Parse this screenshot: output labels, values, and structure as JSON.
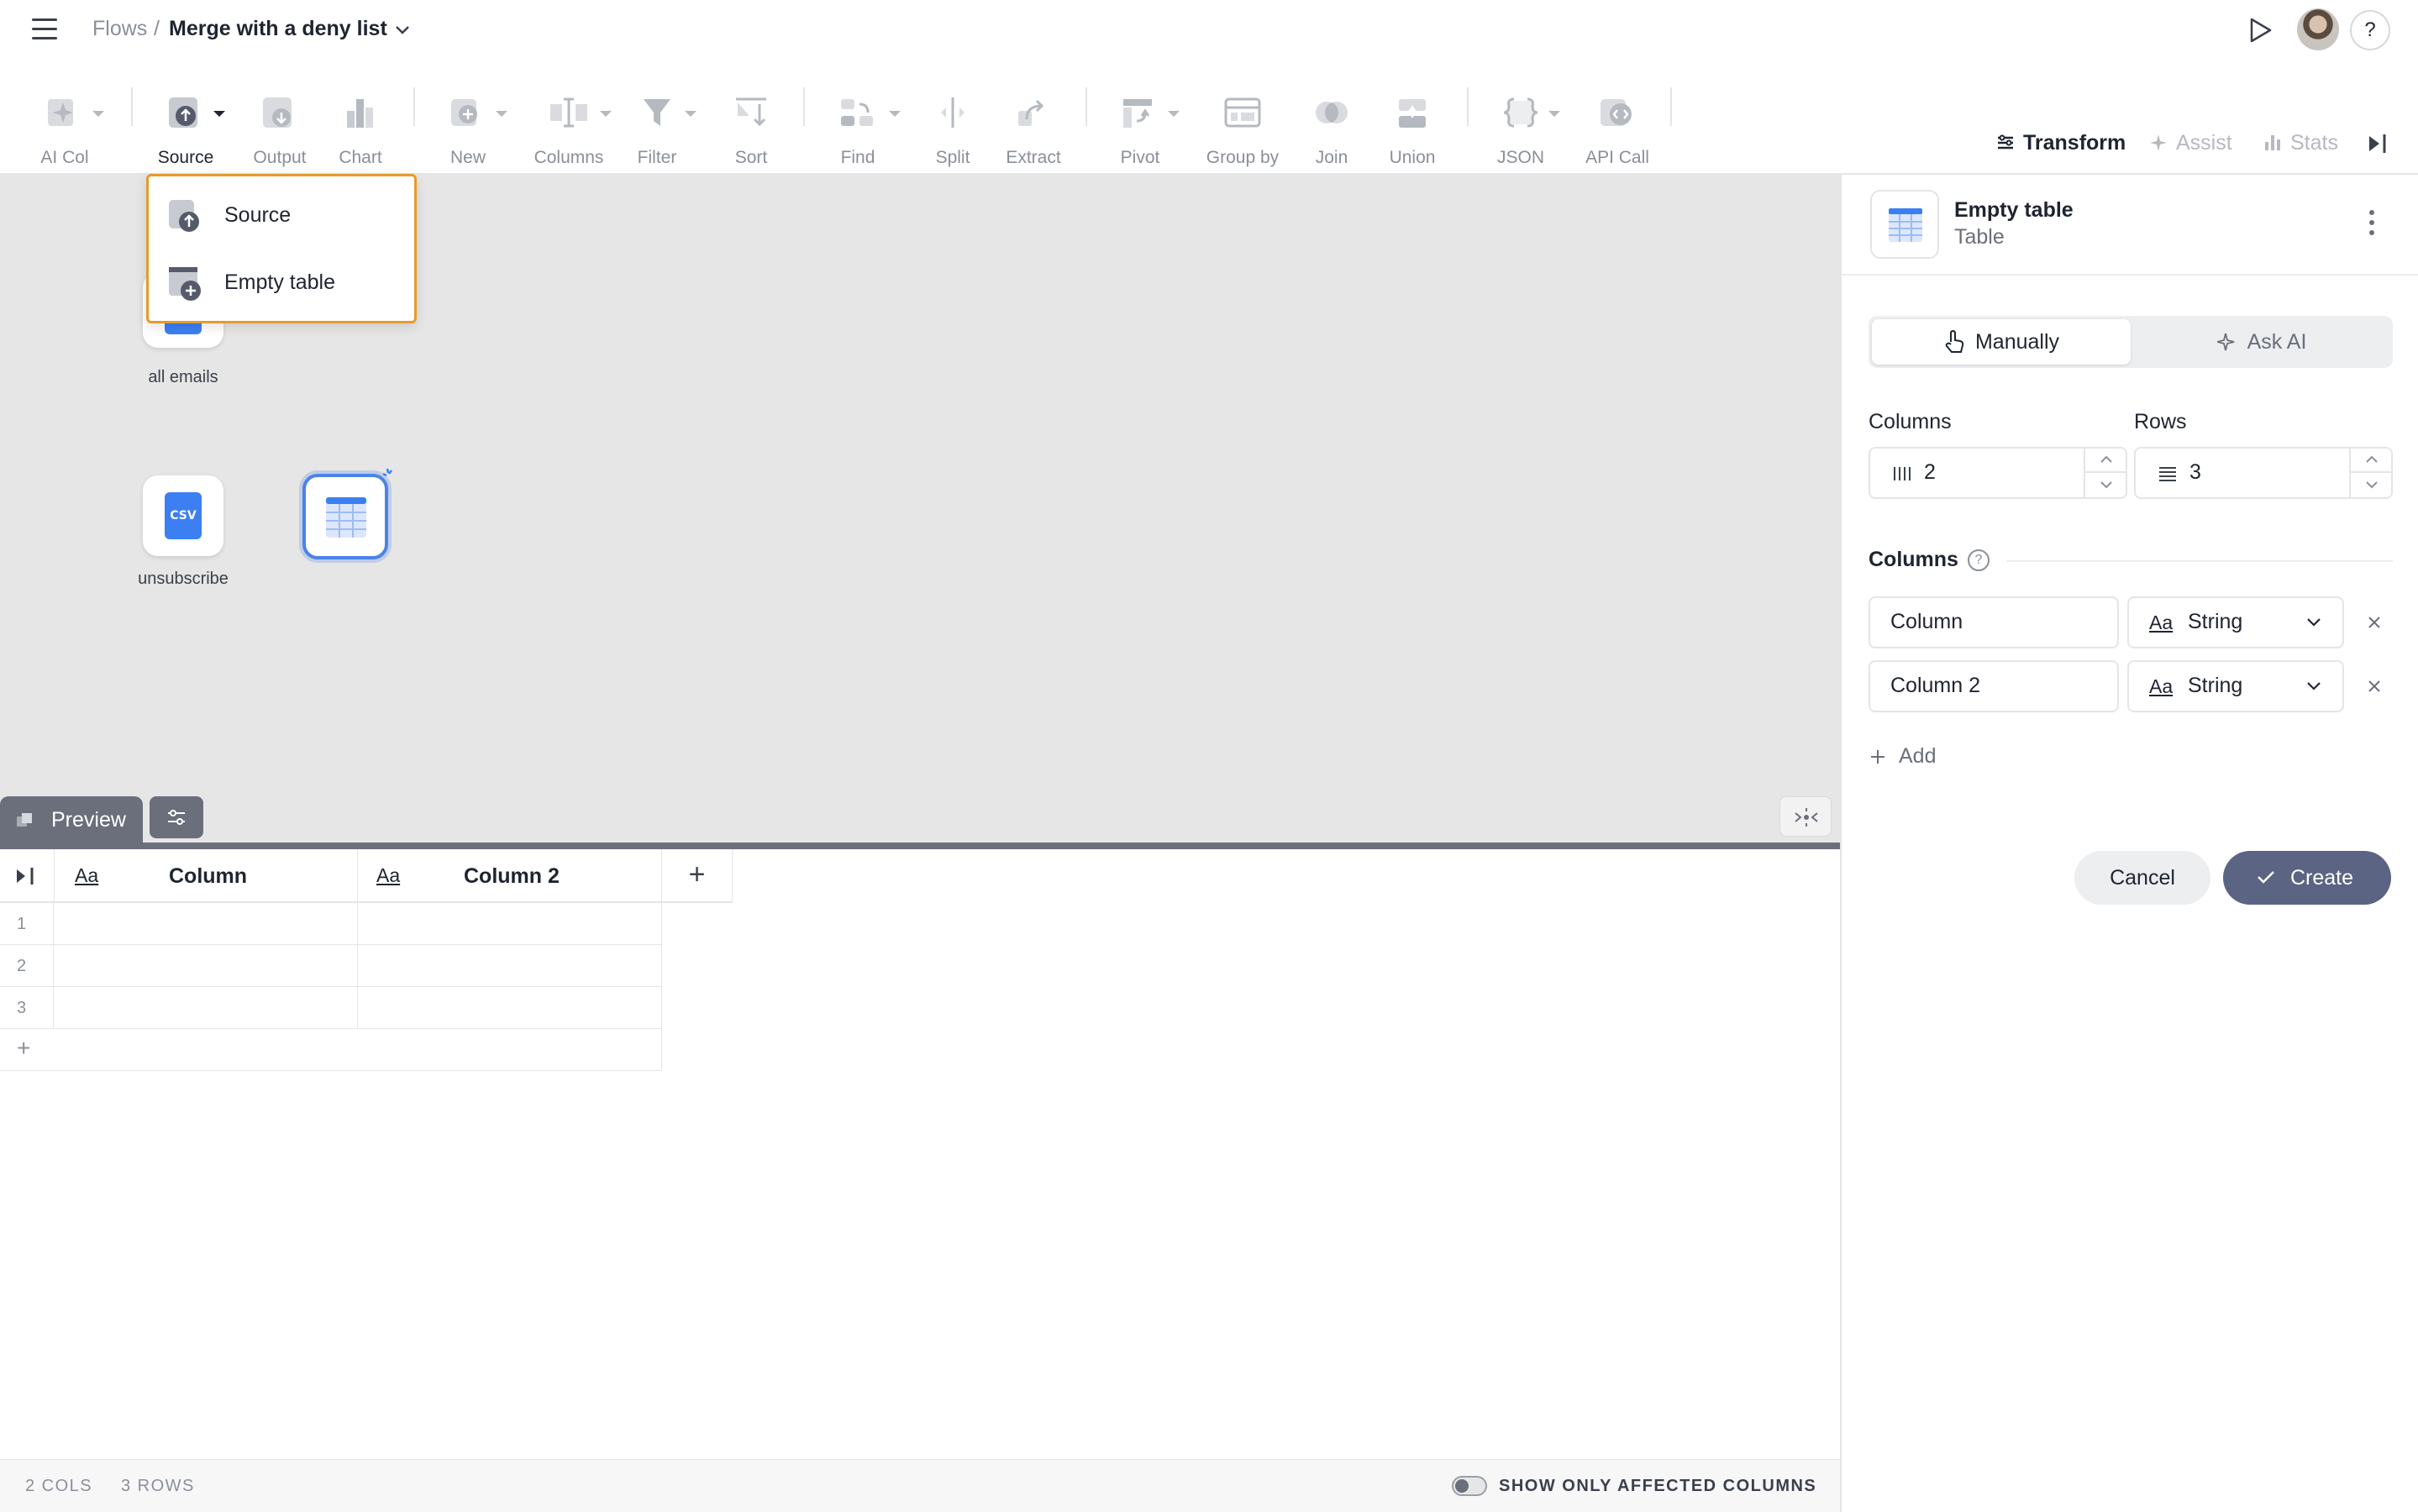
{
  "breadcrumb": {
    "root": "Flows",
    "separator": "/",
    "title": "Merge with a deny list"
  },
  "header": {
    "help_label": "?"
  },
  "toolbar": {
    "tools": [
      {
        "label": "AI Col"
      },
      {
        "label": "Source"
      },
      {
        "label": "Output"
      },
      {
        "label": "Chart"
      },
      {
        "label": "New"
      },
      {
        "label": "Columns"
      },
      {
        "label": "Filter"
      },
      {
        "label": "Sort"
      },
      {
        "label": "Find"
      },
      {
        "label": "Split"
      },
      {
        "label": "Extract"
      },
      {
        "label": "Pivot"
      },
      {
        "label": "Group by"
      },
      {
        "label": "Join"
      },
      {
        "label": "Union"
      },
      {
        "label": "JSON"
      },
      {
        "label": "API Call"
      }
    ],
    "right_tabs": {
      "transform": "Transform",
      "assist": "Assist",
      "stats": "Stats"
    }
  },
  "source_menu": {
    "items": [
      {
        "label": "Source"
      },
      {
        "label": "Empty table"
      }
    ]
  },
  "canvas": {
    "nodes": [
      {
        "label": "all emails"
      },
      {
        "label": "unsubscribe",
        "badge": "CSV"
      },
      {
        "label": ""
      }
    ]
  },
  "preview": {
    "tab_label": "Preview",
    "columns": [
      {
        "type": "Aa",
        "name": "Column"
      },
      {
        "type": "Aa",
        "name": "Column 2"
      }
    ],
    "rows": [
      "1",
      "2",
      "3"
    ],
    "add_row": "+",
    "add_col": "+"
  },
  "status": {
    "cols": "2 COLS",
    "rows": "3 ROWS",
    "toggle_label": "SHOW ONLY AFFECTED COLUMNS",
    "toggle_on": false
  },
  "panel": {
    "title": "Empty table",
    "subtitle": "Table",
    "mode": {
      "manual": "Manually",
      "ai": "Ask AI",
      "selected": "Manually"
    },
    "columns_label": "Columns",
    "rows_label": "Rows",
    "columns_count": "2",
    "rows_count": "3",
    "columns_section": "Columns",
    "column_defs": [
      {
        "name": "Column",
        "type_icon": "Aa",
        "type": "String"
      },
      {
        "name": "Column 2",
        "type_icon": "Aa",
        "type": "String"
      }
    ],
    "add_label": "Add",
    "cancel_label": "Cancel",
    "create_label": "Create"
  },
  "colors": {
    "accent": "#5b6483",
    "highlight": "#e69b2a",
    "canvas_bg": "#e6e6e6",
    "csv_blue": "#3b7ff2"
  }
}
